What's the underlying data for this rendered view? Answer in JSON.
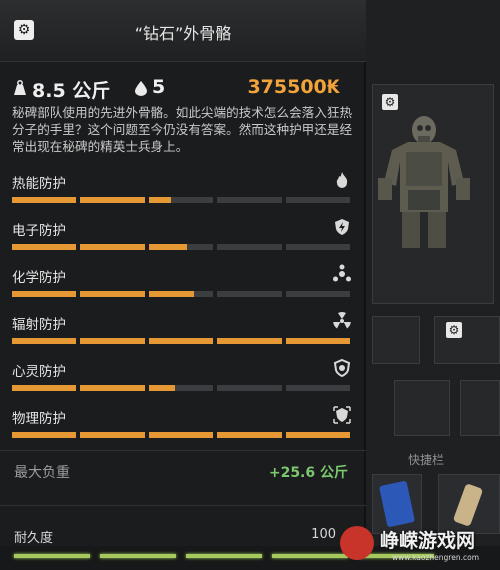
{
  "item": {
    "title": "“钻石”外骨骼",
    "weight": "8.5 公斤",
    "count": "5",
    "price": "375500₭",
    "description": "秘碑部队使用的先进外骨骼。如此尖端的技术怎么会落入狂热分子的手里？这个问题至今仍没有答案。然而这种护甲还是经常出现在秘碑的精英士兵身上。"
  },
  "protections": [
    {
      "label": "热能防护",
      "icon": "fire-icon",
      "level": 0.47
    },
    {
      "label": "电子防护",
      "icon": "shield-bolt-icon",
      "level": 0.52
    },
    {
      "label": "化学防护",
      "icon": "chemical-icon",
      "level": 0.54
    },
    {
      "label": "辐射防护",
      "icon": "radiation-icon",
      "level": 1.0
    },
    {
      "label": "心灵防护",
      "icon": "psy-icon",
      "level": 0.48
    },
    {
      "label": "物理防护",
      "icon": "physical-shield-icon",
      "level": 1.0
    }
  ],
  "max_load": {
    "label": "最大负重",
    "value": "+25.6 公斤"
  },
  "durability": {
    "label": "耐久度",
    "value": "100"
  },
  "inventory": {
    "quickbar_label": "快捷栏"
  },
  "watermark": {
    "text": "峥嵘游戏网",
    "url": "www.kaozhengren.com"
  },
  "colors": {
    "accent": "#e59833",
    "price": "#f2a33a",
    "positive": "#7cc86e",
    "bar_empty": "#3b3d40"
  }
}
